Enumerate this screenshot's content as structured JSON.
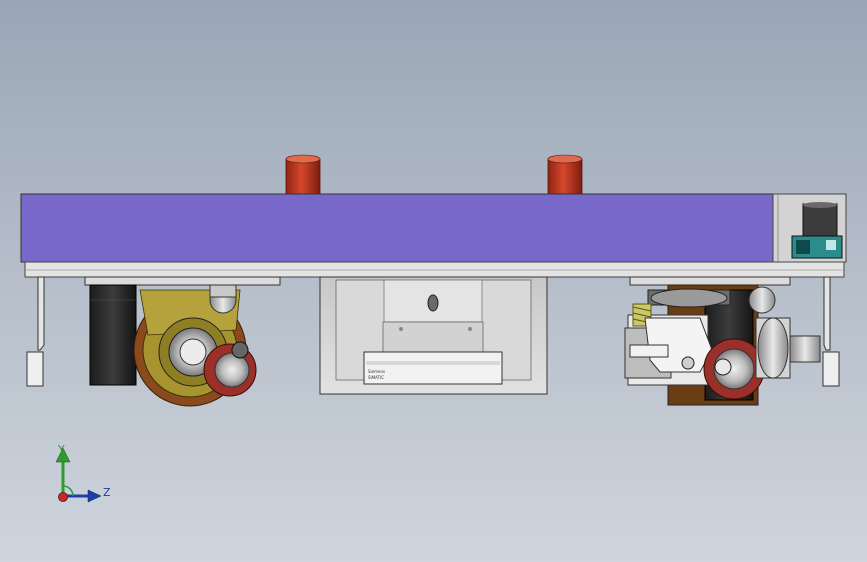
{
  "viewport": {
    "background": [
      "#9aa6b6",
      "#cfd5dd"
    ]
  },
  "model": {
    "body_color": "#7768c9",
    "knob_color": "#c03a22",
    "wheel_tread_color": "#9b2f2a",
    "frame_color": "#e3e3e3",
    "plate": {
      "line1": "Siemens",
      "line2": "SIMATIC"
    }
  },
  "triad": {
    "y_label": "Y",
    "z_label": "Z",
    "y_color": "#2f9a2f",
    "z_color": "#1e3fa8",
    "origin_color": "#c82828"
  }
}
